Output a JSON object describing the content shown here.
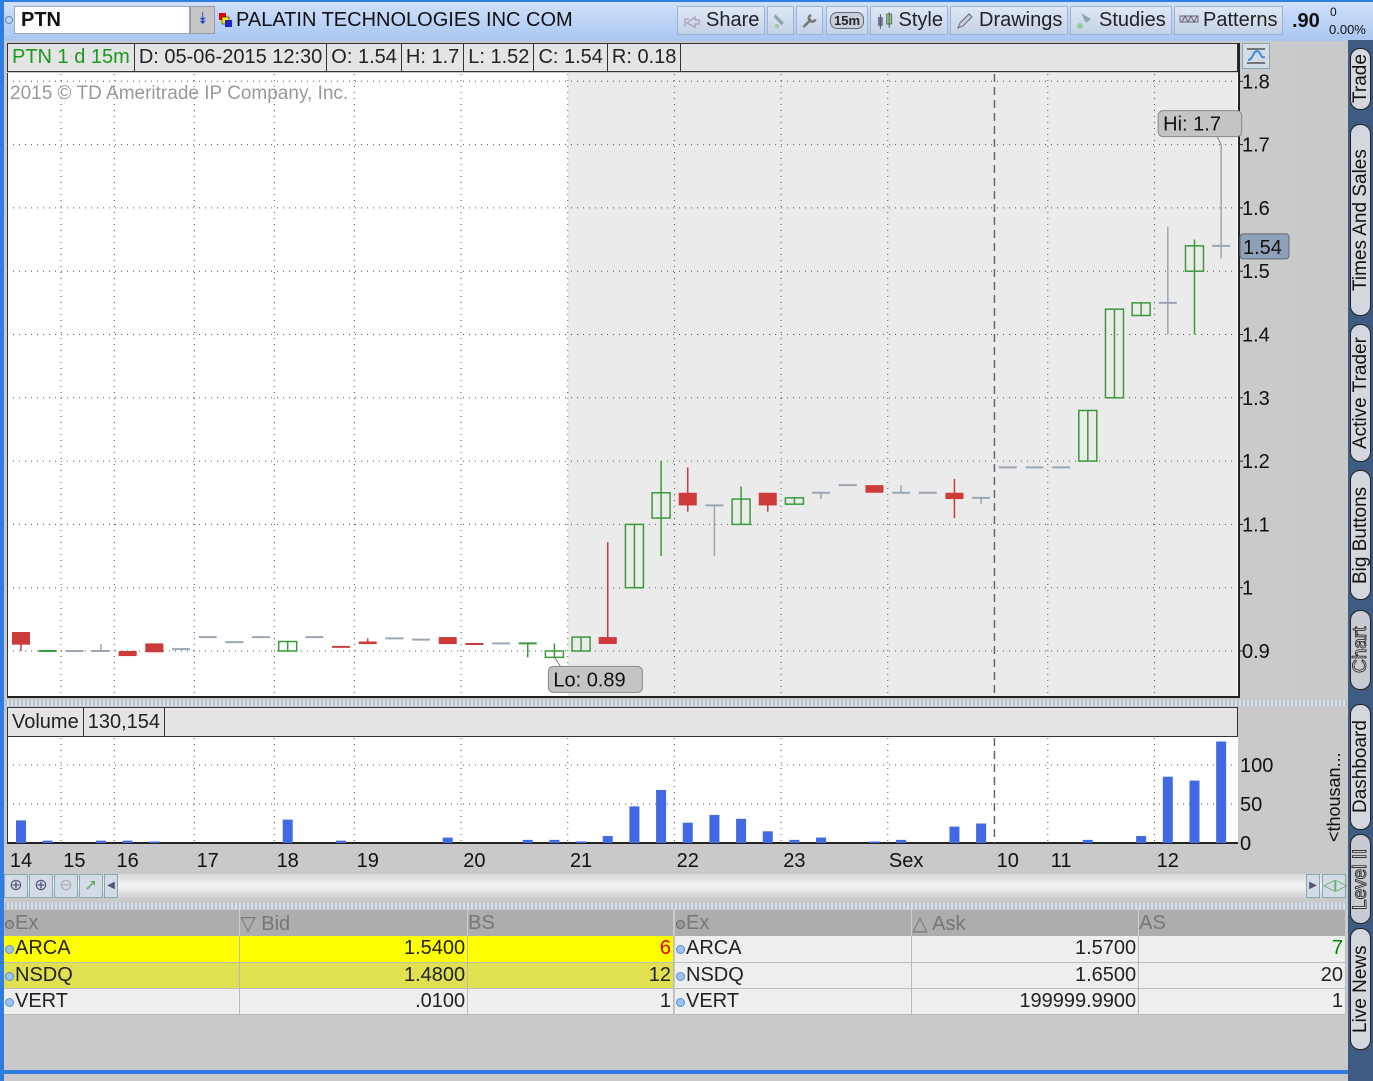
{
  "header": {
    "symbol": "PTN",
    "company": "PALATIN TECHNOLOGIES INC COM",
    "toolbar": {
      "share": "Share",
      "interval": "15m",
      "style": "Style",
      "drawings": "Drawings",
      "studies": "Studies",
      "patterns": "Patterns"
    },
    "last_price": ".90",
    "net_change": "0",
    "pct_change": "0.00%"
  },
  "chart_header": {
    "name": "PTN 1 d 15m",
    "date": "D: 05-06-2015 12:30",
    "open": "O: 1.54",
    "high": "H: 1.7",
    "low": "L: 1.52",
    "close": "C: 1.54",
    "range": "R: 0.18"
  },
  "watermark": "2015 © TD Ameritrade IP Company, Inc.",
  "volume_header": {
    "label": "Volume",
    "value": "130,154",
    "unit_label": "<thousan..."
  },
  "colors": {
    "up": "#3a9a3a",
    "down": "#cc3a3a",
    "flat": "#9aa6b4",
    "volume": "#4169e1",
    "accent": "#2f7de1"
  },
  "chart_data": {
    "type": "candlestick",
    "title": "PTN 1 d 15m",
    "ylim": [
      0.83,
      1.815
    ],
    "y_ticks": [
      "0.9",
      "1",
      "1.1",
      "1.2",
      "1.3",
      "1.4",
      "1.5",
      "1.6",
      "1.7",
      "1.8"
    ],
    "y_tick_values": [
      0.9,
      1.0,
      1.1,
      1.2,
      1.3,
      1.4,
      1.5,
      1.6,
      1.7,
      1.8
    ],
    "volume_ylim": [
      0,
      135
    ],
    "volume_ticks": [
      "0",
      "50",
      "100"
    ],
    "volume_tick_values": [
      0,
      50,
      100
    ],
    "volume_unit": "thousands",
    "x_labels": [
      {
        "label": "14",
        "bar": 0
      },
      {
        "label": "15",
        "bar": 2
      },
      {
        "label": "16",
        "bar": 4
      },
      {
        "label": "17",
        "bar": 7
      },
      {
        "label": "18",
        "bar": 10
      },
      {
        "label": "19",
        "bar": 13
      },
      {
        "label": "20",
        "bar": 17
      },
      {
        "label": "21",
        "bar": 21
      },
      {
        "label": "22",
        "bar": 25
      },
      {
        "label": "23",
        "bar": 29
      },
      {
        "label": "Sex",
        "bar": 33
      },
      {
        "label": "10",
        "bar": 37
      },
      {
        "label": "11",
        "bar": 39
      },
      {
        "label": "12",
        "bar": 43
      }
    ],
    "session_break_bar": 37,
    "shaded_from_bar": 21,
    "hi_label": "Hi: 1.7",
    "lo_label": "Lo: 0.89",
    "last_label": "1.54",
    "last_value": 1.54,
    "hi_bar": 45,
    "hi_value": 1.7,
    "lo_bar": 20,
    "lo_value": 0.89,
    "candles": [
      {
        "o": 0.93,
        "h": 0.93,
        "l": 0.9,
        "c": 0.91,
        "v": 29,
        "d": "down"
      },
      {
        "o": 0.9,
        "h": 0.9,
        "l": 0.9,
        "c": 0.9,
        "v": 3,
        "d": "up"
      },
      {
        "o": 0.9,
        "h": 0.9,
        "l": 0.9,
        "c": 0.9,
        "v": 0,
        "d": "flat"
      },
      {
        "o": 0.9,
        "h": 0.911,
        "l": 0.9,
        "c": 0.9,
        "v": 3,
        "d": "flat"
      },
      {
        "o": 0.9,
        "h": 0.9,
        "l": 0.892,
        "c": 0.892,
        "v": 3,
        "d": "down"
      },
      {
        "o": 0.912,
        "h": 0.912,
        "l": 0.898,
        "c": 0.898,
        "v": 2,
        "d": "down"
      },
      {
        "o": 0.903,
        "h": 0.903,
        "l": 0.903,
        "c": 0.903,
        "v": 0,
        "d": "flat"
      },
      {
        "o": 0.922,
        "h": 0.922,
        "l": 0.922,
        "c": 0.922,
        "v": 0,
        "d": "flat"
      },
      {
        "o": 0.914,
        "h": 0.914,
        "l": 0.914,
        "c": 0.914,
        "v": 0,
        "d": "flat"
      },
      {
        "o": 0.922,
        "h": 0.922,
        "l": 0.922,
        "c": 0.922,
        "v": 0,
        "d": "flat"
      },
      {
        "o": 0.9,
        "h": 0.915,
        "l": 0.9,
        "c": 0.915,
        "v": 30,
        "d": "up"
      },
      {
        "o": 0.922,
        "h": 0.922,
        "l": 0.922,
        "c": 0.922,
        "v": 0,
        "d": "flat"
      },
      {
        "o": 0.908,
        "h": 0.908,
        "l": 0.905,
        "c": 0.905,
        "v": 3,
        "d": "down"
      },
      {
        "o": 0.915,
        "h": 0.92,
        "l": 0.911,
        "c": 0.911,
        "v": 0,
        "d": "down"
      },
      {
        "o": 0.92,
        "h": 0.92,
        "l": 0.92,
        "c": 0.92,
        "v": 0,
        "d": "flat"
      },
      {
        "o": 0.918,
        "h": 0.918,
        "l": 0.918,
        "c": 0.918,
        "v": 0,
        "d": "flat"
      },
      {
        "o": 0.922,
        "h": 0.922,
        "l": 0.911,
        "c": 0.911,
        "v": 7,
        "d": "down"
      },
      {
        "o": 0.913,
        "h": 0.913,
        "l": 0.911,
        "c": 0.911,
        "v": 0,
        "d": "down"
      },
      {
        "o": 0.912,
        "h": 0.912,
        "l": 0.912,
        "c": 0.912,
        "v": 0,
        "d": "flat"
      },
      {
        "o": 0.912,
        "h": 0.912,
        "l": 0.89,
        "c": 0.912,
        "v": 4,
        "d": "up"
      },
      {
        "o": 0.89,
        "h": 0.912,
        "l": 0.89,
        "c": 0.9,
        "v": 4,
        "d": "up"
      },
      {
        "o": 0.9,
        "h": 0.922,
        "l": 0.9,
        "c": 0.922,
        "v": 2,
        "d": "up"
      },
      {
        "o": 0.922,
        "h": 1.072,
        "l": 0.911,
        "c": 0.911,
        "v": 9,
        "d": "down"
      },
      {
        "o": 1.0,
        "h": 1.1,
        "l": 1.0,
        "c": 1.1,
        "v": 47,
        "d": "up"
      },
      {
        "o": 1.11,
        "h": 1.2,
        "l": 1.05,
        "c": 1.15,
        "v": 68,
        "d": "up"
      },
      {
        "o": 1.15,
        "h": 1.19,
        "l": 1.12,
        "c": 1.13,
        "v": 26,
        "d": "down"
      },
      {
        "o": 1.13,
        "h": 1.13,
        "l": 1.05,
        "c": 1.13,
        "v": 36,
        "d": "flat"
      },
      {
        "o": 1.1,
        "h": 1.16,
        "l": 1.1,
        "c": 1.14,
        "v": 31,
        "d": "up"
      },
      {
        "o": 1.15,
        "h": 1.15,
        "l": 1.12,
        "c": 1.13,
        "v": 15,
        "d": "down"
      },
      {
        "o": 1.132,
        "h": 1.142,
        "l": 1.132,
        "c": 1.142,
        "v": 4,
        "d": "up"
      },
      {
        "o": 1.15,
        "h": 1.15,
        "l": 1.14,
        "c": 1.15,
        "v": 7,
        "d": "flat"
      },
      {
        "o": 1.162,
        "h": 1.162,
        "l": 1.162,
        "c": 1.162,
        "v": 0,
        "d": "flat"
      },
      {
        "o": 1.162,
        "h": 1.162,
        "l": 1.15,
        "c": 1.15,
        "v": 2,
        "d": "down"
      },
      {
        "o": 1.15,
        "h": 1.162,
        "l": 1.15,
        "c": 1.15,
        "v": 4,
        "d": "flat"
      },
      {
        "o": 1.15,
        "h": 1.15,
        "l": 1.15,
        "c": 1.15,
        "v": 0,
        "d": "flat"
      },
      {
        "o": 1.15,
        "h": 1.172,
        "l": 1.11,
        "c": 1.14,
        "v": 21,
        "d": "down"
      },
      {
        "o": 1.142,
        "h": 1.142,
        "l": 1.132,
        "c": 1.142,
        "v": 25,
        "d": "flat"
      },
      {
        "o": 1.19,
        "h": 1.19,
        "l": 1.19,
        "c": 1.19,
        "v": 0,
        "d": "flat"
      },
      {
        "o": 1.19,
        "h": 1.19,
        "l": 1.19,
        "c": 1.19,
        "v": 0,
        "d": "flat"
      },
      {
        "o": 1.19,
        "h": 1.19,
        "l": 1.19,
        "c": 1.19,
        "v": 0,
        "d": "flat"
      },
      {
        "o": 1.2,
        "h": 1.28,
        "l": 1.2,
        "c": 1.28,
        "v": 4,
        "d": "up"
      },
      {
        "o": 1.3,
        "h": 1.44,
        "l": 1.3,
        "c": 1.44,
        "v": 0,
        "d": "up"
      },
      {
        "o": 1.43,
        "h": 1.45,
        "l": 1.43,
        "c": 1.45,
        "v": 9,
        "d": "up"
      },
      {
        "o": 1.45,
        "h": 1.57,
        "l": 1.4,
        "c": 1.45,
        "v": 85,
        "d": "flat"
      },
      {
        "o": 1.5,
        "h": 1.55,
        "l": 1.4,
        "c": 1.54,
        "v": 80,
        "d": "up"
      },
      {
        "o": 1.54,
        "h": 1.7,
        "l": 1.52,
        "c": 1.54,
        "v": 130.154,
        "d": "flat"
      }
    ]
  },
  "level2": {
    "bid_headers": {
      "ex": "Ex",
      "bid": "▽ Bid",
      "size": "BS"
    },
    "ask_headers": {
      "ex": "Ex",
      "ask": "△ Ask",
      "size": "AS"
    },
    "bids": [
      {
        "ex": "ARCA",
        "price": "1.5400",
        "size": "6"
      },
      {
        "ex": "NSDQ",
        "price": "1.4800",
        "size": "12"
      },
      {
        "ex": "VERT",
        "price": ".0100",
        "size": "1"
      }
    ],
    "asks": [
      {
        "ex": "ARCA",
        "price": "1.5700",
        "size": "7"
      },
      {
        "ex": "NSDQ",
        "price": "1.6500",
        "size": "20"
      },
      {
        "ex": "VERT",
        "price": "199999.9900",
        "size": "1"
      }
    ]
  },
  "sidebar_tabs": [
    "Trade",
    "Times And Sales",
    "Active Trader",
    "Big Buttons",
    "Chart",
    "Dashboard",
    "Level II",
    "Live News"
  ]
}
